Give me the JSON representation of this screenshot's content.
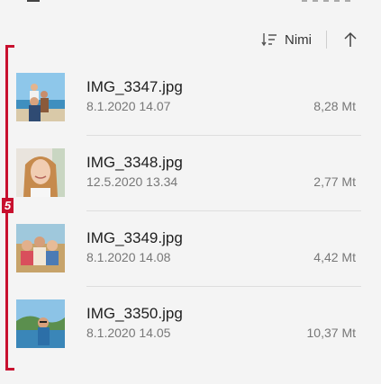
{
  "sort": {
    "label": "Nimi",
    "icon": "sort-lines-icon",
    "direction_icon": "arrow-up-icon"
  },
  "annotation": {
    "badge": "5"
  },
  "files": [
    {
      "name": "IMG_3347.jpg",
      "date": "8.1.2020 14.07",
      "size": "8,28 Mt"
    },
    {
      "name": "IMG_3348.jpg",
      "date": "12.5.2020 13.34",
      "size": "2,77 Mt"
    },
    {
      "name": "IMG_3349.jpg",
      "date": "8.1.2020 14.08",
      "size": "4,42 Mt"
    },
    {
      "name": "IMG_3350.jpg",
      "date": "8.1.2020 14.05",
      "size": "10,37 Mt"
    }
  ],
  "colors": {
    "accent": "#c8102e",
    "background": "#f4f4f4",
    "secondary_text": "#777777"
  }
}
